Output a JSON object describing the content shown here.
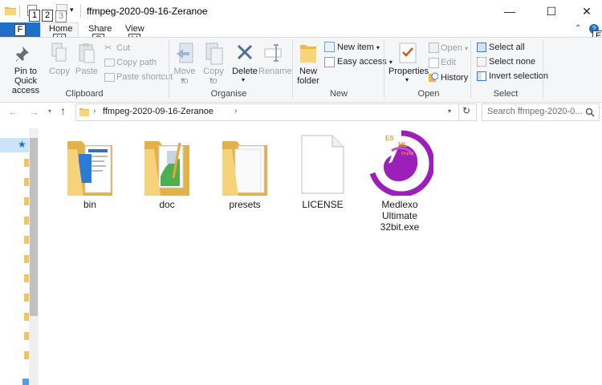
{
  "window": {
    "title": "ffmpeg-2020-09-16-Zeranoe",
    "minimize": "—",
    "maximize": "☐",
    "close": "✕"
  },
  "keytips": {
    "qat1": "1",
    "qat2": "2",
    "qat3": "3",
    "file": "F",
    "home": "H",
    "share": "S",
    "view": "V",
    "expand": "E"
  },
  "tabs": {
    "file": "F",
    "home": "Home",
    "share": "Share",
    "view": "View"
  },
  "ribbon": {
    "clipboard": {
      "label": "Clipboard",
      "pin": "Pin to Quick access",
      "copy": "Copy",
      "paste": "Paste",
      "cut": "Cut",
      "copy_path": "Copy path",
      "paste_shortcut": "Paste shortcut"
    },
    "organise": {
      "label": "Organise",
      "move_to": "Move to",
      "copy_to": "Copy to",
      "delete": "Delete",
      "rename": "Rename"
    },
    "new": {
      "label": "New",
      "new_folder": "New folder",
      "new_item": "New item",
      "easy_access": "Easy access"
    },
    "open": {
      "label": "Open",
      "properties": "Properties",
      "open": "Open",
      "edit": "Edit",
      "history": "History"
    },
    "select": {
      "label": "Select",
      "select_all": "Select all",
      "select_none": "Select none",
      "invert": "Invert selection"
    }
  },
  "address": {
    "path": "ffmpeg-2020-09-16-Zeranoe",
    "search_placeholder": "Search ffmpeg-2020-0..."
  },
  "files": [
    {
      "name": "bin",
      "type": "folder"
    },
    {
      "name": "doc",
      "type": "folder"
    },
    {
      "name": "presets",
      "type": "folder"
    },
    {
      "name": "LICENSE",
      "type": "file"
    },
    {
      "name": "Medlexo Ultimate 32bit.exe",
      "type": "exe",
      "logo_text": [
        "ES",
        "ML",
        "ffmpeg"
      ]
    }
  ],
  "colors": {
    "accent": "#1e6fc8",
    "folder": "#f2c55c",
    "exe_purple": "#9b1fb8",
    "logo_orange": "#f0a030"
  }
}
